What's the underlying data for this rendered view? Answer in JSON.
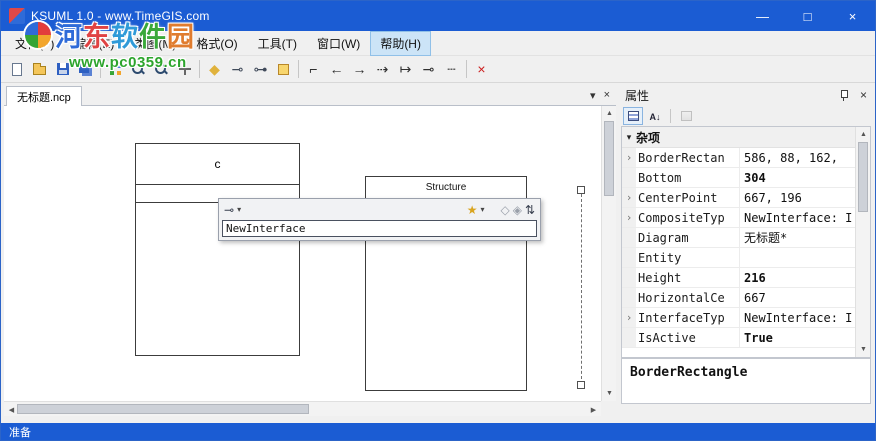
{
  "window": {
    "title": "KSUML 1.0 - www.TimeGIS.com",
    "controls": {
      "minimize": "—",
      "maximize": "□",
      "close": "×"
    }
  },
  "menu": {
    "items": [
      "文件(F)",
      "编辑(E)",
      "类图(M)",
      "格式(O)",
      "工具(T)",
      "窗口(W)",
      "帮助(H)"
    ],
    "active_item": "帮助(H)"
  },
  "watermark": {
    "chars": [
      {
        "ch": "河",
        "color": "#2f6bd8"
      },
      {
        "ch": "东",
        "color": "#e04343"
      },
      {
        "ch": "软",
        "color": "#2f9ad8"
      },
      {
        "ch": "件",
        "color": "#3aa83a"
      },
      {
        "ch": "园",
        "color": "#e07c2e"
      }
    ],
    "url": "www.pc0359.cn",
    "url_color": "#2da52d"
  },
  "toolbar": {
    "items": [
      {
        "name": "new-file",
        "type": "css"
      },
      {
        "name": "open-file",
        "type": "css"
      },
      {
        "name": "save-file",
        "type": "css"
      },
      {
        "name": "save-all",
        "type": "css"
      },
      {
        "name": "sep"
      },
      {
        "name": "fit-window",
        "type": "css"
      },
      {
        "name": "zoom-out",
        "type": "css"
      },
      {
        "name": "zoom-in",
        "type": "css"
      },
      {
        "name": "pan-tool",
        "type": "css"
      },
      {
        "name": "sep"
      },
      {
        "name": "new-class",
        "glyph": "◆",
        "color": "#e0b23c"
      },
      {
        "name": "new-interface",
        "glyph": "⊸",
        "color": "#404a5a"
      },
      {
        "name": "new-association",
        "glyph": "⊶",
        "color": "#404a5a"
      },
      {
        "name": "new-note",
        "type": "css"
      },
      {
        "name": "sep"
      },
      {
        "name": "elbow-connector",
        "glyph": "⌐",
        "color": "#303030"
      },
      {
        "name": "arrow-left",
        "glyph": "←",
        "color": "#303030"
      },
      {
        "name": "arrow-right",
        "glyph": "→",
        "color": "#303030"
      },
      {
        "name": "dashed-arrow",
        "glyph": "⇢",
        "color": "#303030"
      },
      {
        "name": "bar-arrow",
        "glyph": "↦",
        "color": "#303030"
      },
      {
        "name": "circle-connector",
        "glyph": "⊸",
        "color": "#303030"
      },
      {
        "name": "dotted-line",
        "glyph": "┄",
        "color": "#303030"
      },
      {
        "name": "sep"
      },
      {
        "name": "delete",
        "glyph": "×",
        "color": "#cc2020"
      }
    ]
  },
  "doc": {
    "tab_label": "无标题.ncp",
    "tab_menu_icon": "▾",
    "tab_close_icon": "×"
  },
  "canvas": {
    "class_box": {
      "title": "c"
    },
    "struct_box": {
      "stereotype": "Structure"
    },
    "editor": {
      "value": "NewInterface",
      "icons": {
        "connector": "⊸",
        "dropdown": "▾",
        "add": "★",
        "dropdown2": "▾",
        "fields": "◇",
        "props": "◈",
        "sort": "⇅"
      }
    }
  },
  "properties": {
    "panel_title": "属性",
    "close_icon": "×",
    "collapse_icon": "▾",
    "category_label": "杂项",
    "rows": [
      {
        "name": "BorderRectan",
        "value": "586, 88, 162,",
        "expand": true,
        "bold": false
      },
      {
        "name": "Bottom",
        "value": "304",
        "expand": false,
        "bold": true
      },
      {
        "name": "CenterPoint",
        "value": "667, 196",
        "expand": true,
        "bold": false
      },
      {
        "name": "CompositeTyp",
        "value": "NewInterface: I",
        "expand": true,
        "bold": false
      },
      {
        "name": "Diagram",
        "value": "无标题*",
        "expand": false,
        "bold": false
      },
      {
        "name": "Entity",
        "value": "",
        "expand": false,
        "bold": false
      },
      {
        "name": "Height",
        "value": "216",
        "expand": false,
        "bold": true
      },
      {
        "name": "HorizontalCe",
        "value": "667",
        "expand": false,
        "bold": false
      },
      {
        "name": "InterfaceTyp",
        "value": "NewInterface: I",
        "expand": true,
        "bold": false
      },
      {
        "name": "IsActive",
        "value": "True",
        "expand": false,
        "bold": true
      }
    ],
    "description_title": "BorderRectangle"
  },
  "status": {
    "text": "准备"
  }
}
